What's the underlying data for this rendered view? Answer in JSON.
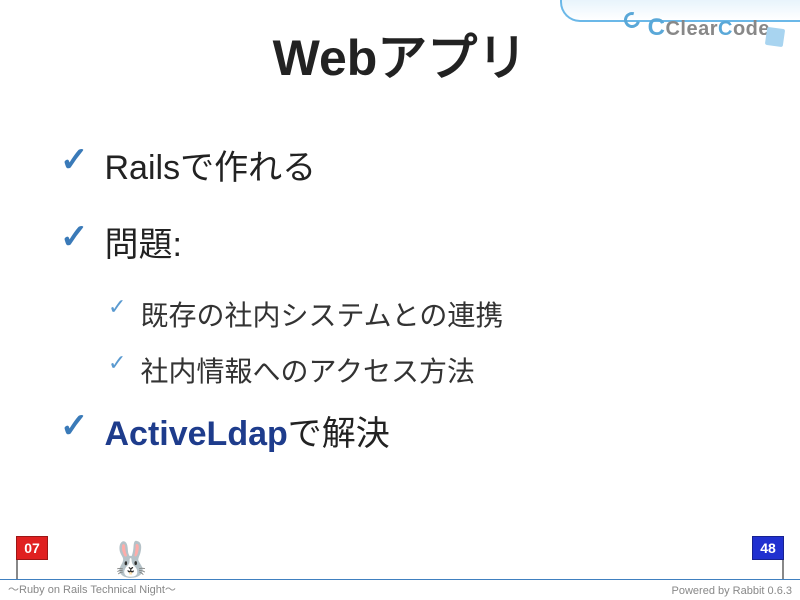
{
  "logo": {
    "text_clear": "Clear",
    "text_code": "ode",
    "c_big": "C",
    "c_mid": "C"
  },
  "title": "Webアプリ",
  "bullets": {
    "item1": "Railsで作れる",
    "item2": "問題:",
    "sub1": "既存の社内システムとの連携",
    "sub2": "社内情報へのアクセス方法",
    "item3_strong": "ActiveLdap",
    "item3_rest": "で解決"
  },
  "footer": {
    "left": "〜Ruby on Rails Technical Night〜",
    "right": "Powered by Rabbit 0.6.3",
    "current_page": "07",
    "total_pages": "48"
  }
}
